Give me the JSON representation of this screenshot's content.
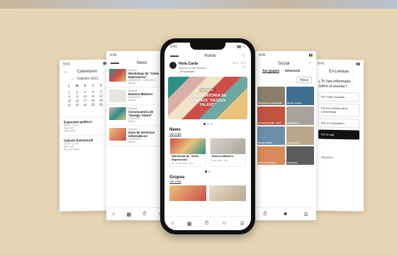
{
  "calendar": {
    "time": "9:41",
    "title": "Calendario",
    "month": "Febrero 2021",
    "weekdays": [
      "L",
      "M",
      "X",
      "J",
      "V"
    ],
    "days": [
      "1",
      "2",
      "3",
      "4",
      "5",
      "8",
      "9",
      "10",
      "11",
      "12",
      "15",
      "16",
      "17",
      "18",
      "19",
      "22",
      "23",
      "24",
      "25",
      "26"
    ],
    "events": [
      {
        "title": "Expresión gráfica I",
        "time": "09:15 - 10:15",
        "room": "Aula 107",
        "teacher": "Pablo Díaz"
      },
      {
        "title": "Cálculo Estructural",
        "time": "10:30 - 12:30",
        "room": "Aula 105",
        "teacher": "Susana Ferrer"
      }
    ]
  },
  "news": {
    "time": "9:41",
    "title": "News",
    "items": [
      {
        "category": "Eventos",
        "title": "Workshop de \"Artes Expresivos\"",
        "date": "16/04/2022 · 16/04/2022",
        "place": "Studio"
      },
      {
        "category": "Noticias",
        "title": "Nuevos Másters",
        "date": "14/04/2022",
        "place": "Studio"
      },
      {
        "category": "Eventos",
        "title": "Convocatoria de \"Design Talent\"",
        "date": "14/04/2022",
        "place": "Studio"
      },
      {
        "category": "Noticias",
        "title": "Guía de servicios informáticos",
        "date": "10/04/2022",
        "place": "Studio"
      }
    ]
  },
  "home": {
    "time": "9:41",
    "title": "Home",
    "greeting": "Hola Carla",
    "date_line": "Hoy es 17 de Febrero",
    "sub_line": "¿Preparada?",
    "weather": "10°C · 12°C",
    "poster_tag": "1 21 ABRIL",
    "poster_title": "CONVOCATORIA DE PREMIOS \"DESIGN TALENT\"",
    "news_heading": "News",
    "see_more": "Ver más",
    "cards": [
      {
        "title": "Workshop de \"Artes Expresivos\"",
        "meta": "20 - 30 abr 2022 · 9:00"
      },
      {
        "title": "Nuevos Másters",
        "meta": "3 abr 2022 · 9:00"
      }
    ],
    "groups_heading": "Grupos",
    "groups_see_more": "Ver más"
  },
  "social": {
    "time": "9:41",
    "title": "Social",
    "tabs": [
      "Tus grupos",
      "Directorio"
    ],
    "filter": "Filtros",
    "tiles": [
      "Workshop de fotografía",
      "Diseño gráfico",
      "Promoción 2020 - 2022",
      "Estudiantes",
      "Dibujo Digital",
      "Arquitectura",
      "Venta de material",
      "Tipografía"
    ]
  },
  "surveys": {
    "time": "9:41",
    "title": "Encuestas",
    "question": "¿Te has informado sobre el evento?",
    "options": [
      "Por redes sociales",
      "Por los carteles de la Universidad",
      "Por un compañero",
      "Por la app"
    ],
    "footer": "Siguiente"
  },
  "colors": {
    "background": "#e6d5b4",
    "accent": "#111111"
  }
}
